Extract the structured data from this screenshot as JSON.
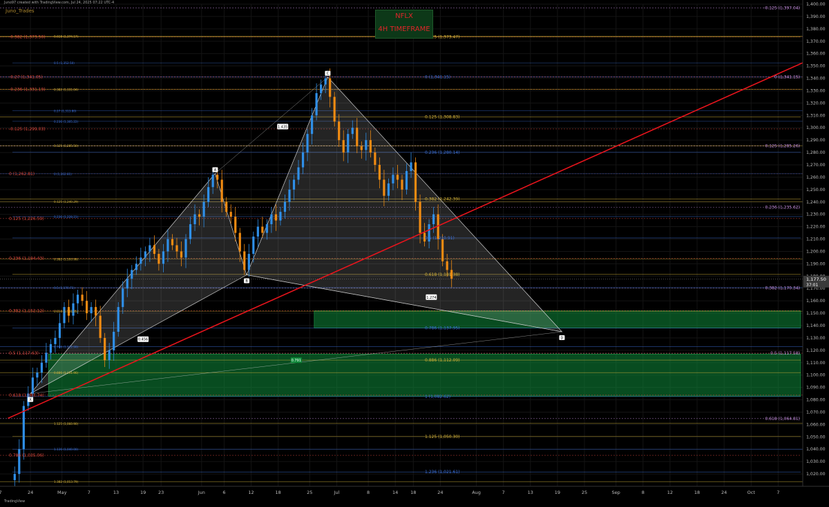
{
  "header": {
    "credit": "Juno97 created with TradingView.com, Jul 24, 2025 07:22 UTC-4",
    "author": "Juno_Trades",
    "title": "NFLX",
    "subtitle": "4H TIMEFRAME",
    "brand": "TradingView"
  },
  "colors": {
    "background": "#000000",
    "trendline": "#e8141c",
    "harmonic": "#ffffff",
    "demand_zone": "#0f8a3a",
    "bull_candle": "#2f8fe8",
    "bear_candle": "#f08b12",
    "fib_yellow": "#d6b43a",
    "fib_magenta": "#c08ad8",
    "fib_blue": "#3c6fd8",
    "fib_red": "#d8473c"
  },
  "chart_data": {
    "type": "candlestick",
    "symbol": "NFLX",
    "timeframe": "4H",
    "ylim": [
      1010,
      1400
    ],
    "yticks": [
      1020,
      1030,
      1040,
      1050,
      1060,
      1070,
      1080,
      1090,
      1100,
      1110,
      1120,
      1130,
      1140,
      1150,
      1160,
      1170,
      1180,
      1190,
      1200,
      1210,
      1220,
      1230,
      1240,
      1250,
      1260,
      1270,
      1280,
      1290,
      1300,
      1310,
      1320,
      1330,
      1340,
      1350,
      1360,
      1370,
      1380,
      1390,
      1400
    ],
    "xticks": [
      {
        "label": "11",
        "day": -9
      },
      {
        "label": "17",
        "day": -3
      },
      {
        "label": "24",
        "day": 4
      },
      {
        "label": "May",
        "day": 11
      },
      {
        "label": "7",
        "day": 17
      },
      {
        "label": "13",
        "day": 23
      },
      {
        "label": "19",
        "day": 29
      },
      {
        "label": "23",
        "day": 33
      },
      {
        "label": "Jun",
        "day": 42
      },
      {
        "label": "6",
        "day": 47
      },
      {
        "label": "12",
        "day": 53
      },
      {
        "label": "18",
        "day": 59
      },
      {
        "label": "25",
        "day": 66
      },
      {
        "label": "Jul",
        "day": 72
      },
      {
        "label": "8",
        "day": 79
      },
      {
        "label": "14",
        "day": 85
      },
      {
        "label": "18",
        "day": 89
      },
      {
        "label": "24",
        "day": 95
      },
      {
        "label": "Aug",
        "day": 103
      },
      {
        "label": "7",
        "day": 109
      },
      {
        "label": "13",
        "day": 115
      },
      {
        "label": "19",
        "day": 121
      },
      {
        "label": "25",
        "day": 127
      },
      {
        "label": "Sep",
        "day": 134
      },
      {
        "label": "8",
        "day": 140
      },
      {
        "label": "12",
        "day": 146
      },
      {
        "label": "18",
        "day": 152
      },
      {
        "label": "24",
        "day": 158
      },
      {
        "label": "Oct",
        "day": 164
      },
      {
        "label": "7",
        "day": 170
      }
    ],
    "last_price": "1,177.50",
    "countdown": "37:01",
    "last_value": 1177.5,
    "trendline": {
      "from": [
        -1,
        1065
      ],
      "to": [
        180,
        1360
      ]
    },
    "harmonic_points": [
      {
        "label": "X",
        "day": 4,
        "value": 1085
      },
      {
        "label": "A",
        "day": 45,
        "value": 1263
      },
      {
        "label": "B",
        "day": 52,
        "value": 1181
      },
      {
        "label": "C",
        "day": 70,
        "value": 1341
      },
      {
        "label": "D",
        "day": 122,
        "value": 1135
      }
    ],
    "harmonic_ratios": [
      {
        "label": "0.456",
        "day": 29,
        "value": 1129
      },
      {
        "label": "1.435",
        "day": 60,
        "value": 1301
      },
      {
        "label": "0.791",
        "day": 63,
        "value": 1112
      },
      {
        "label": "1.274",
        "day": 93,
        "value": 1163
      }
    ],
    "zones": [
      {
        "name": "upper",
        "x0": 67,
        "x1": 175,
        "y0": 1138,
        "y1": 1152
      },
      {
        "name": "lower",
        "x0": 8,
        "x1": 175,
        "y0": 1083,
        "y1": 1117
      }
    ],
    "fib_lines": [
      {
        "value": 1397.04,
        "x0": -10,
        "x1": 175,
        "color": "magenta",
        "label": "-0.125 (1,397.04)",
        "pos": "right"
      },
      {
        "value": 1373.47,
        "x0": -10,
        "x1": 175,
        "color": "yellow",
        "label": "0.125 (1,373.47)",
        "pos": "center"
      },
      {
        "value": 1373.5,
        "x0": -10,
        "x1": 0,
        "color": "red",
        "label": "-0.382 (1,373.50)",
        "pos": "left"
      },
      {
        "value": 1374.17,
        "x0": -10,
        "x1": 0,
        "color": "yellow",
        "label": "0.618 (1,374.17)",
        "pos": "left-inner"
      },
      {
        "value": 1352.5,
        "x0": 0,
        "x1": 175,
        "color": "blue",
        "label": "0.5 (1,352.50)",
        "pos": "left-inner"
      },
      {
        "value": 1341.15,
        "x0": -10,
        "x1": 175,
        "color": "magenta",
        "label": "0 (1,341.15)",
        "pos": "right"
      },
      {
        "value": 1341.15,
        "x0": -10,
        "x1": 0,
        "color": "blue",
        "label": "0 (1,341.15)",
        "pos": "center"
      },
      {
        "value": 1341.05,
        "x0": -10,
        "x1": 0,
        "color": "red",
        "label": "-0.27 (1,341.05)",
        "pos": "left"
      },
      {
        "value": 1331.19,
        "x0": -10,
        "x1": 175,
        "color": "red",
        "label": "-0.236 (1,331.19)",
        "pos": "left"
      },
      {
        "value": 1331.04,
        "x0": -10,
        "x1": 0,
        "color": "yellow",
        "label": "0.382 (1,331.04)",
        "pos": "left-inner"
      },
      {
        "value": 1308.83,
        "x0": -10,
        "x1": 175,
        "color": "yellow",
        "label": "0.125 (1,308.83)",
        "pos": "center"
      },
      {
        "value": 1313.8,
        "x0": 0,
        "x1": 0,
        "color": "blue",
        "label": "0.27 (1,313.80)",
        "pos": "left-inner"
      },
      {
        "value": 1305.22,
        "x0": 0,
        "x1": 0,
        "color": "blue",
        "label": "0.236 (1,305.22)",
        "pos": "left-inner"
      },
      {
        "value": 1299.03,
        "x0": -10,
        "x1": 175,
        "color": "red",
        "label": "-0.125 (1,299.03)",
        "pos": "left"
      },
      {
        "value": 1285.26,
        "x0": -10,
        "x1": 175,
        "color": "magenta",
        "label": "0.125 (1,285.26)",
        "pos": "right"
      },
      {
        "value": 1285.5,
        "x0": -10,
        "x1": 0,
        "color": "yellow",
        "label": "0.125 (1,285.50)",
        "pos": "left-inner"
      },
      {
        "value": 1280.14,
        "x0": 0,
        "x1": 175,
        "color": "blue",
        "label": "0.236 (1,280.14)",
        "pos": "center"
      },
      {
        "value": 1262.81,
        "x0": -10,
        "x1": 0,
        "color": "red",
        "label": "0 (1,262.81)",
        "pos": "left"
      },
      {
        "value": 1262.81,
        "x0": -10,
        "x1": 0,
        "color": "blue",
        "label": "0 (1,262.81)",
        "pos": "left-inner"
      },
      {
        "value": 1242.39,
        "x0": -10,
        "x1": 175,
        "color": "yellow",
        "label": "0.382 (1,242.39)",
        "pos": "center"
      },
      {
        "value": 1240.29,
        "x0": -10,
        "x1": 0,
        "color": "yellow",
        "label": "0.125 (1,240.29)",
        "pos": "left-inner"
      },
      {
        "value": 1235.62,
        "x0": -10,
        "x1": 175,
        "color": "magenta",
        "label": "0.236 (1,235.62)",
        "pos": "right"
      },
      {
        "value": 1228.21,
        "x0": 0,
        "x1": 0,
        "color": "blue",
        "label": "0.236 (1,228.21)",
        "pos": "left-inner"
      },
      {
        "value": 1226.59,
        "x0": -10,
        "x1": 175,
        "color": "red",
        "label": "0.125 (1,226.59)",
        "pos": "left"
      },
      {
        "value": 1210.91,
        "x0": 0,
        "x1": 175,
        "color": "blue",
        "label": "0.5 (1,210.91)",
        "pos": "center"
      },
      {
        "value": 1194.43,
        "x0": -10,
        "x1": 175,
        "color": "red",
        "label": "0.236 (1,194.43)",
        "pos": "left"
      },
      {
        "value": 1193.98,
        "x0": -10,
        "x1": 0,
        "color": "yellow",
        "label": "0.382 (1,193.98)",
        "pos": "left-inner"
      },
      {
        "value": 1181.38,
        "x0": 0,
        "x1": 175,
        "color": "yellow",
        "label": "0.618 (1,181.38)",
        "pos": "center"
      },
      {
        "value": 1170.34,
        "x0": -10,
        "x1": 175,
        "color": "magenta",
        "label": "0.382 (1,170.34)",
        "pos": "right"
      },
      {
        "value": 1170.71,
        "x0": -10,
        "x1": 0,
        "color": "blue",
        "label": "0.5 (1,170.71)",
        "pos": "left-inner"
      },
      {
        "value": 1152.12,
        "x0": -10,
        "x1": 175,
        "color": "red",
        "label": "0.382 (1,152.12)",
        "pos": "left"
      },
      {
        "value": 1151.65,
        "x0": -10,
        "x1": 0,
        "color": "yellow",
        "label": "0.618 (1,151.65)",
        "pos": "left-inner"
      },
      {
        "value": 1137.95,
        "x0": 0,
        "x1": 175,
        "color": "blue",
        "label": "0.786 (1,137.95)",
        "pos": "center"
      },
      {
        "value": 1117.58,
        "x0": -10,
        "x1": 175,
        "color": "magenta",
        "label": "0.5 (1,117.58)",
        "pos": "right"
      },
      {
        "value": 1117.63,
        "x0": -10,
        "x1": 0,
        "color": "red",
        "label": "0.5 (1,117.63)",
        "pos": "left"
      },
      {
        "value": 1112.09,
        "x0": -10,
        "x1": 175,
        "color": "yellow",
        "label": "0.886 (1,112.09)",
        "pos": "center"
      },
      {
        "value": 1122.9,
        "x0": -10,
        "x1": 0,
        "color": "blue",
        "label": "0.786 (1,122.90)",
        "pos": "left-inner"
      },
      {
        "value": 1101.96,
        "x0": -10,
        "x1": 175,
        "color": "yellow",
        "label": "0.886 (1,101.96)",
        "pos": "left-inner"
      },
      {
        "value": 1083.74,
        "x0": -10,
        "x1": 0,
        "color": "red",
        "label": "0.618 (1,083.74)",
        "pos": "left"
      },
      {
        "value": 1082.62,
        "x0": 0,
        "x1": 175,
        "color": "blue",
        "label": "1 (1,082.62)",
        "pos": "center"
      },
      {
        "value": 1064.81,
        "x0": -10,
        "x1": 175,
        "color": "magenta",
        "label": "0.618 (1,064.81)",
        "pos": "right"
      },
      {
        "value": 1060.9,
        "x0": -10,
        "x1": 0,
        "color": "yellow",
        "label": "1.125 (1,060.90)",
        "pos": "left-inner"
      },
      {
        "value": 1050.3,
        "x0": 0,
        "x1": 175,
        "color": "yellow",
        "label": "1.125 (1,050.30)",
        "pos": "center"
      },
      {
        "value": 1040.0,
        "x0": 0,
        "x1": 0,
        "color": "blue",
        "label": "1.136 (1,040.00)",
        "pos": "left-inner"
      },
      {
        "value": 1035.06,
        "x0": -10,
        "x1": 175,
        "color": "red",
        "label": "0.786 (1,035.06)",
        "pos": "left"
      },
      {
        "value": 1021.61,
        "x0": 0,
        "x1": 175,
        "color": "blue",
        "label": "1.236 (1,021.61)",
        "pos": "center"
      },
      {
        "value": 1013.79,
        "x0": -10,
        "x1": 0,
        "color": "yellow",
        "label": "1.382 (1,013.79)",
        "pos": "left-inner"
      }
    ],
    "path": [
      [
        0,
        1015
      ],
      [
        1,
        1020
      ],
      [
        2,
        1040
      ],
      [
        3,
        1075
      ],
      [
        4,
        1085
      ],
      [
        5,
        1098
      ],
      [
        6,
        1102
      ],
      [
        7,
        1110
      ],
      [
        8,
        1118
      ],
      [
        9,
        1125
      ],
      [
        10,
        1130
      ],
      [
        11,
        1142
      ],
      [
        12,
        1155
      ],
      [
        13,
        1148
      ],
      [
        14,
        1158
      ],
      [
        15,
        1165
      ],
      [
        16,
        1160
      ],
      [
        17,
        1150
      ],
      [
        18,
        1155
      ],
      [
        19,
        1148
      ],
      [
        20,
        1130
      ],
      [
        21,
        1112
      ],
      [
        22,
        1120
      ],
      [
        23,
        1135
      ],
      [
        24,
        1155
      ],
      [
        25,
        1170
      ],
      [
        26,
        1178
      ],
      [
        27,
        1185
      ],
      [
        28,
        1190
      ],
      [
        29,
        1195
      ],
      [
        30,
        1200
      ],
      [
        31,
        1205
      ],
      [
        32,
        1198
      ],
      [
        33,
        1190
      ],
      [
        34,
        1200
      ],
      [
        35,
        1210
      ],
      [
        36,
        1205
      ],
      [
        37,
        1200
      ],
      [
        38,
        1195
      ],
      [
        39,
        1210
      ],
      [
        40,
        1222
      ],
      [
        41,
        1230
      ],
      [
        42,
        1228
      ],
      [
        43,
        1240
      ],
      [
        44,
        1252
      ],
      [
        45,
        1262
      ],
      [
        46,
        1258
      ],
      [
        47,
        1240
      ],
      [
        48,
        1232
      ],
      [
        49,
        1228
      ],
      [
        50,
        1215
      ],
      [
        51,
        1200
      ],
      [
        52,
        1185
      ],
      [
        53,
        1198
      ],
      [
        54,
        1212
      ],
      [
        55,
        1220
      ],
      [
        56,
        1215
      ],
      [
        57,
        1222
      ],
      [
        58,
        1230
      ],
      [
        59,
        1225
      ],
      [
        60,
        1232
      ],
      [
        61,
        1240
      ],
      [
        62,
        1250
      ],
      [
        63,
        1258
      ],
      [
        64,
        1268
      ],
      [
        65,
        1280
      ],
      [
        66,
        1295
      ],
      [
        67,
        1310
      ],
      [
        68,
        1328
      ],
      [
        69,
        1335
      ],
      [
        70,
        1340
      ],
      [
        71,
        1325
      ],
      [
        72,
        1305
      ],
      [
        73,
        1290
      ],
      [
        74,
        1280
      ],
      [
        75,
        1295
      ],
      [
        76,
        1300
      ],
      [
        77,
        1285
      ],
      [
        78,
        1282
      ],
      [
        79,
        1290
      ],
      [
        80,
        1280
      ],
      [
        81,
        1270
      ],
      [
        82,
        1258
      ],
      [
        83,
        1245
      ],
      [
        84,
        1255
      ],
      [
        85,
        1262
      ],
      [
        86,
        1258
      ],
      [
        87,
        1250
      ],
      [
        88,
        1265
      ],
      [
        89,
        1272
      ],
      [
        90,
        1240
      ],
      [
        91,
        1215
      ],
      [
        92,
        1208
      ],
      [
        93,
        1222
      ],
      [
        94,
        1230
      ],
      [
        95,
        1210
      ],
      [
        96,
        1192
      ],
      [
        97,
        1185
      ],
      [
        98,
        1178
      ]
    ]
  }
}
